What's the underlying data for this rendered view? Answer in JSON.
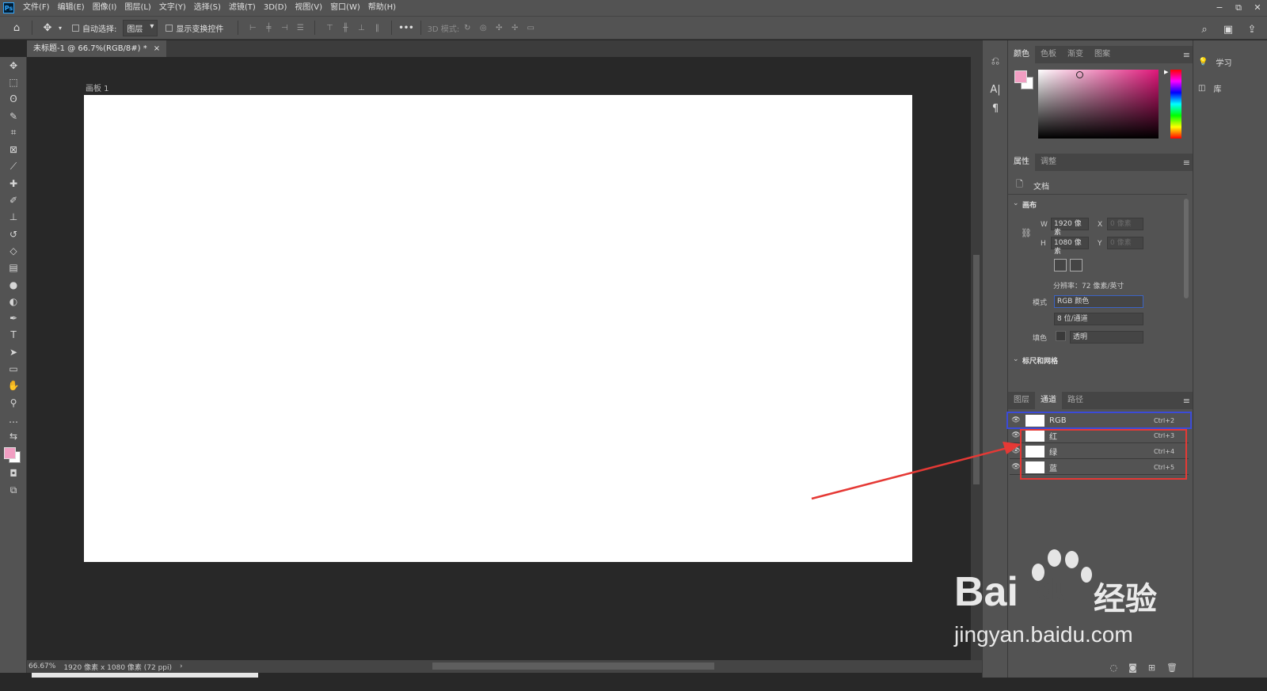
{
  "menubar": {
    "logo": "Ps",
    "items": [
      "文件(F)",
      "编辑(E)",
      "图像(I)",
      "图层(L)",
      "文字(Y)",
      "选择(S)",
      "滤镜(T)",
      "3D(D)",
      "视图(V)",
      "窗口(W)",
      "帮助(H)"
    ],
    "window_controls": [
      "−",
      "⧉",
      "✕"
    ]
  },
  "options": {
    "auto_select_label": "自动选择:",
    "layer_select": "图层",
    "show_transform_label": "显示变换控件",
    "more": "•••",
    "mode_3d_label": "3D 模式:"
  },
  "document": {
    "tab_title": "未标题-1 @ 66.7%(RGB/8#) *",
    "tab_close": "×",
    "artboard_label": "画板 1"
  },
  "status": {
    "zoom": "66.67%",
    "doc_info": "1920 像素 x 1080 像素 (72 ppi)",
    "arrow": "›"
  },
  "color_panel": {
    "tabs": [
      "颜色",
      "色板",
      "渐变",
      "图案"
    ],
    "foreground_color": "#f19ec2",
    "background_color": "#ffffff",
    "picker_hue": "#e0177a"
  },
  "properties_panel": {
    "tabs": [
      "属性",
      "调整"
    ],
    "doc_label": "文档",
    "canvas_section": "画布",
    "w_label": "W",
    "w_value": "1920 像素",
    "h_label": "H",
    "h_value": "1080 像素",
    "x_label": "X",
    "x_value": "0 像素",
    "y_label": "Y",
    "y_value": "0 像素",
    "resolution": "分辨率：72 像素/英寸",
    "mode_label": "模式",
    "mode_value": "RGB 颜色",
    "depth_value": "8 位/通道",
    "fill_label": "填色",
    "fill_value": "透明",
    "rulers_section": "标尺和网格"
  },
  "channels_panel": {
    "tabs": [
      "图层",
      "通道",
      "路径"
    ],
    "rows": [
      {
        "name": "RGB",
        "shortcut": "Ctrl+2"
      },
      {
        "name": "红",
        "shortcut": "Ctrl+3"
      },
      {
        "name": "绿",
        "shortcut": "Ctrl+4"
      },
      {
        "name": "蓝",
        "shortcut": "Ctrl+5"
      }
    ],
    "highlight_blue": "#3b4bd8",
    "highlight_red": "#e53935"
  },
  "right_column": {
    "learn_label": "学习",
    "library_label": "库"
  },
  "watermark": {
    "brand": "Bai",
    "brand2": "du",
    "brand_cn": "经验",
    "url": "jingyan.baidu.com"
  }
}
